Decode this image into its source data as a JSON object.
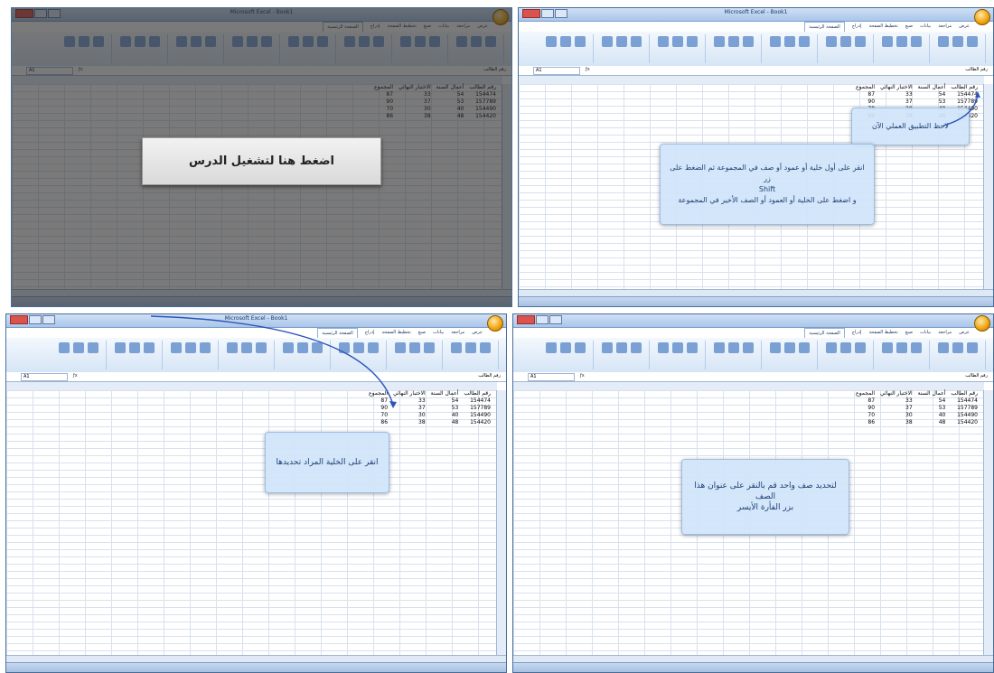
{
  "window_title": "Microsoft Excel - Book1",
  "ribbon_tabs": [
    "الصفحة الرئيسية",
    "إدراج",
    "تخطيط الصفحة",
    "صيغ",
    "بيانات",
    "مراجعة",
    "عرض"
  ],
  "cell_ref": "A1",
  "formula_value": "رقم الطالب",
  "headers": [
    "رقم الطالب",
    "أعمال السنة",
    "الاختبار النهائي",
    "المجموع"
  ],
  "rows": [
    [
      "154474",
      "54",
      "33",
      "87"
    ],
    [
      "157789",
      "53",
      "37",
      "90"
    ],
    [
      "154490",
      "40",
      "30",
      "70"
    ],
    [
      "154420",
      "48",
      "38",
      "86"
    ]
  ],
  "panel1": {
    "play_label": "اضغط هنا لتشغيل الدرس"
  },
  "panel2": {
    "note": "لاحظ التطبيق العملي الآن",
    "instruction_l1": "انقر على أول خلية أو عمود أو صف في المجموعة ثم الضغط على زر",
    "instruction_l2": "Shift",
    "instruction_l3": "و اضغط على الخلية أو العمود أو الصف الأخير في المجموعة"
  },
  "panel3": {
    "instruction": "انقر على الخلية المراد تحديدها"
  },
  "panel4": {
    "instruction_l1": "لتحديد صف واحد قم بالنقر على عنوان هذا الصف",
    "instruction_l2": "بزر الفأرة الأيسر"
  },
  "colors": {
    "ribbon": "#d6e5f6",
    "callout": "#d0e4fa",
    "accent": "#1d3f73"
  }
}
